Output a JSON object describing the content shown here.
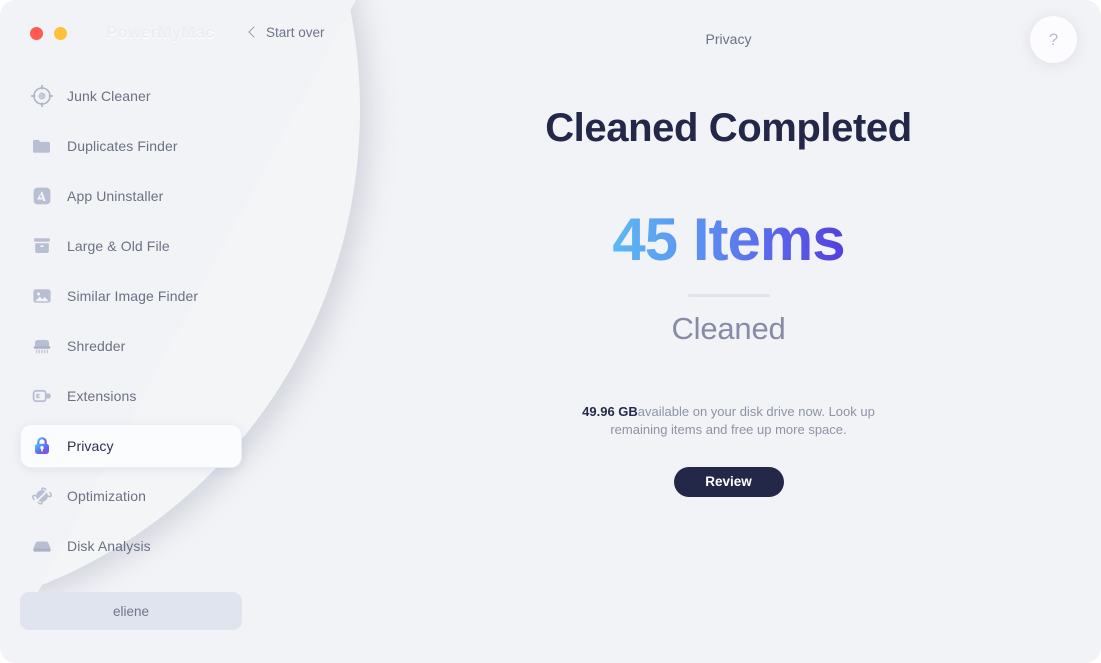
{
  "window": {
    "brand": "PowerMyMac",
    "traffic_lights": [
      "close",
      "minimize"
    ]
  },
  "titlebar": {
    "start_over_label": "Start over",
    "page_title": "Privacy",
    "help_label": "?"
  },
  "sidebar": {
    "items": [
      {
        "label": "Junk Cleaner",
        "icon": "target-icon",
        "active": false
      },
      {
        "label": "Duplicates Finder",
        "icon": "folder-icon",
        "active": false
      },
      {
        "label": "App Uninstaller",
        "icon": "app-box-icon",
        "active": false
      },
      {
        "label": "Large & Old File",
        "icon": "archive-box-icon",
        "active": false
      },
      {
        "label": "Similar Image Finder",
        "icon": "image-icon",
        "active": false
      },
      {
        "label": "Shredder",
        "icon": "shredder-icon",
        "active": false
      },
      {
        "label": "Extensions",
        "icon": "puzzle-plug-icon",
        "active": false
      },
      {
        "label": "Privacy",
        "icon": "lock-icon",
        "active": true
      },
      {
        "label": "Optimization",
        "icon": "rocket-orbit-icon",
        "active": false
      },
      {
        "label": "Disk Analysis",
        "icon": "hard-drive-icon",
        "active": false
      }
    ],
    "account_label": "eliene"
  },
  "main": {
    "headline": "Cleaned Completed",
    "count": "45 Items",
    "count_caption": "Cleaned",
    "description_bold": "49.96 GB",
    "description_rest": "available on your disk drive now. Look up remaining items and free up more space.",
    "review_label": "Review"
  },
  "colors": {
    "accent_gradient_start": "#5cb9f4",
    "accent_gradient_end": "#5340dd",
    "dark_navy": "#232748",
    "sidebar_bg": "#f2f3f6",
    "main_bg": "#f4f5f7",
    "muted_text": "#6b7185",
    "traffic_red": "#ff5b52",
    "traffic_yellow": "#ffc13c"
  }
}
